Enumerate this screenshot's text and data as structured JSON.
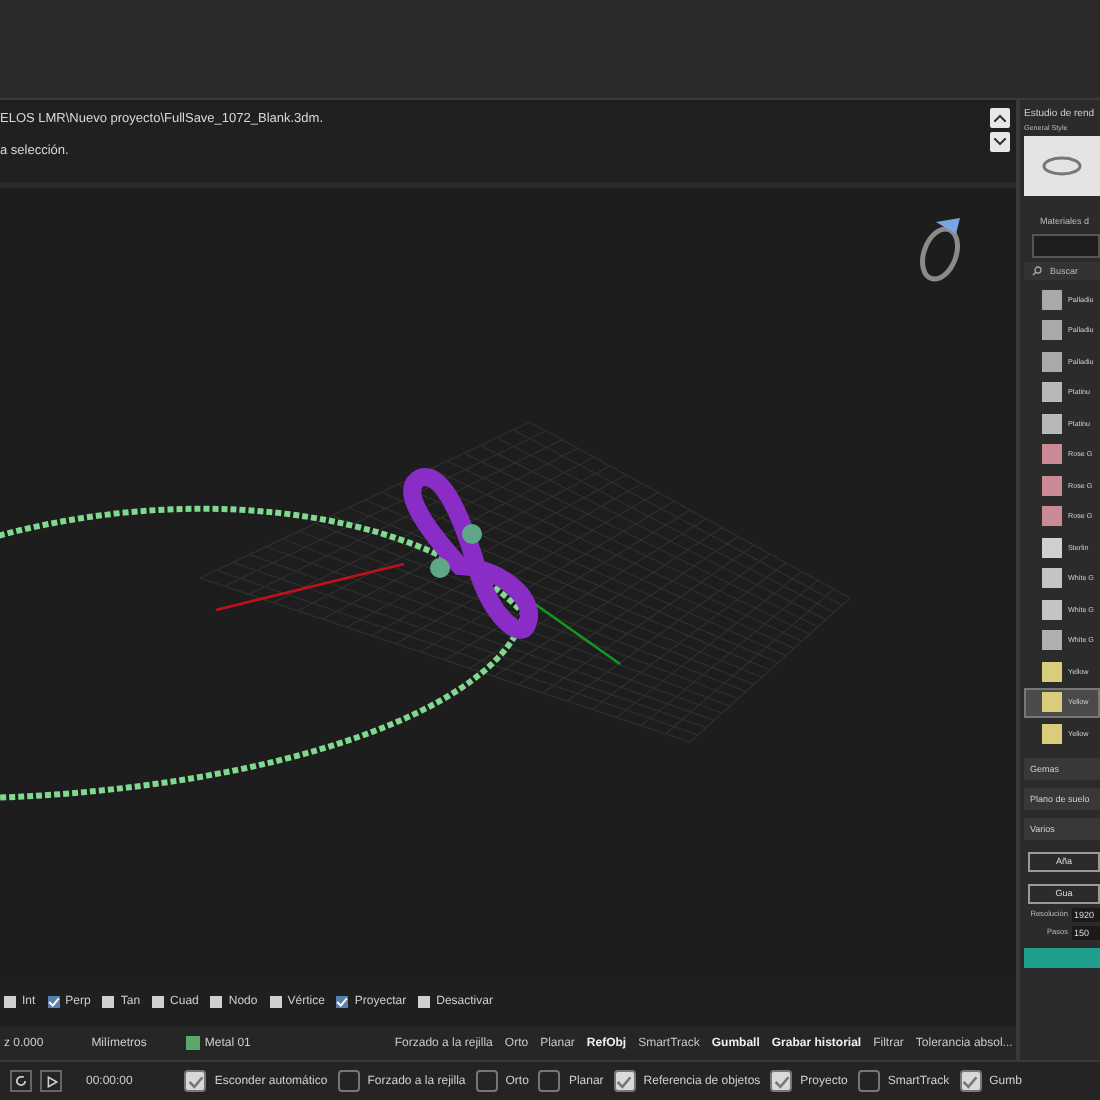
{
  "command_history": {
    "lines": [
      "ELOS LMR\\Nuevo proyecto\\FullSave_1072_Blank.3dm.",
      "a selección."
    ]
  },
  "osnaps": [
    {
      "label": "Int",
      "checked": false
    },
    {
      "label": "Perp",
      "checked": true
    },
    {
      "label": "Tan",
      "checked": false
    },
    {
      "label": "Cuad",
      "checked": false
    },
    {
      "label": "Nodo",
      "checked": false
    },
    {
      "label": "Vértice",
      "checked": false
    },
    {
      "label": "Proyectar",
      "checked": true
    },
    {
      "label": "Desactivar",
      "checked": false
    }
  ],
  "status_bar": {
    "coordinate": "z 0.000",
    "units": "Milímetros",
    "layer": {
      "label": "Metal 01",
      "color": "#5aa86c"
    },
    "toggles": [
      {
        "label": "Forzado a la rejilla",
        "on": false
      },
      {
        "label": "Orto",
        "on": false
      },
      {
        "label": "Planar",
        "on": false
      },
      {
        "label": "RefObj",
        "on": true
      },
      {
        "label": "SmartTrack",
        "on": false
      },
      {
        "label": "Gumball",
        "on": true
      },
      {
        "label": "Grabar historial",
        "on": true
      },
      {
        "label": "Filtrar",
        "on": false
      },
      {
        "label": "Tolerancia absol...",
        "on": false
      }
    ]
  },
  "bottom_bar": {
    "time": "00:00:00",
    "checks": [
      {
        "label": "Esconder automático",
        "checked": true
      },
      {
        "label": "Forzado a la rejilla",
        "checked": false
      },
      {
        "label": "Orto",
        "checked": false
      },
      {
        "label": "Planar",
        "checked": false
      },
      {
        "label": "Referencia de objetos",
        "checked": true
      },
      {
        "label": "Proyecto",
        "checked": true
      },
      {
        "label": "SmartTrack",
        "checked": false
      },
      {
        "label": "Gumb",
        "checked": true
      }
    ]
  },
  "render_panel": {
    "title": "Estudio de rend",
    "style_label": "General Style",
    "materials_label": "Materiales d",
    "search_placeholder": "Buscar",
    "materials": [
      {
        "label": "Palladiu",
        "color": "#a9a9a9",
        "selected": false
      },
      {
        "label": "Palladiu",
        "color": "#a9a9a9",
        "selected": false
      },
      {
        "label": "Palladiu",
        "color": "#a9a9a9",
        "selected": false
      },
      {
        "label": "Platinu",
        "color": "#b8b8b8",
        "selected": false
      },
      {
        "label": "Platinu",
        "color": "#b8b8b8",
        "selected": false
      },
      {
        "label": "Rose G",
        "color": "#c98a96",
        "selected": false
      },
      {
        "label": "Rose G",
        "color": "#c98a96",
        "selected": false
      },
      {
        "label": "Rose G",
        "color": "#c98a96",
        "selected": false
      },
      {
        "label": "Sterlin",
        "color": "#d0d0d0",
        "selected": false
      },
      {
        "label": "White G",
        "color": "#c4c4c4",
        "selected": false
      },
      {
        "label": "White G",
        "color": "#c4c4c4",
        "selected": false
      },
      {
        "label": "White G",
        "color": "#b0b0b0",
        "selected": false
      },
      {
        "label": "Yellow",
        "color": "#d9cc7a",
        "selected": false
      },
      {
        "label": "Yellow",
        "color": "#d9cc7a",
        "selected": true
      },
      {
        "label": "Yellow",
        "color": "#d9cc7a",
        "selected": false
      }
    ],
    "sections": [
      "Gemas",
      "Plano de suelo",
      "Varios"
    ],
    "buttons": [
      "Aña",
      "Gua"
    ],
    "fields": [
      {
        "label": "Resolución",
        "value": "1920"
      },
      {
        "label": "Pasos",
        "value": "150"
      }
    ]
  }
}
